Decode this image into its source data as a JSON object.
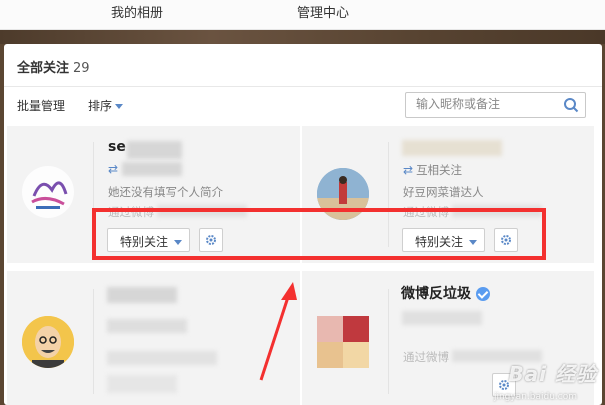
{
  "topnav": {
    "album": "我的相册",
    "manage": "管理中心"
  },
  "panel": {
    "title": "全部关注",
    "count": "29"
  },
  "toolbar": {
    "batch": "批量管理",
    "sort": "排序"
  },
  "search": {
    "placeholder": "输入昵称或备注"
  },
  "cards": [
    {
      "name": "se",
      "meta1": "她还没有填写个人简介",
      "meta2": "通过微博",
      "follow_label": "特别关注"
    },
    {
      "meta1": "互相关注",
      "meta2": "好豆网菜谱达人",
      "meta3": "通过微博",
      "follow_label": "特别关注"
    },
    {},
    {
      "name": "微博反垃圾",
      "meta": "通过微博"
    }
  ],
  "watermark": {
    "brand": "Bai 经验",
    "url": "jingyan.baidu.com"
  },
  "colors": {
    "accent": "#5a88c7",
    "highlight_box": "#f3302f",
    "verified": "#5a9cf0"
  }
}
